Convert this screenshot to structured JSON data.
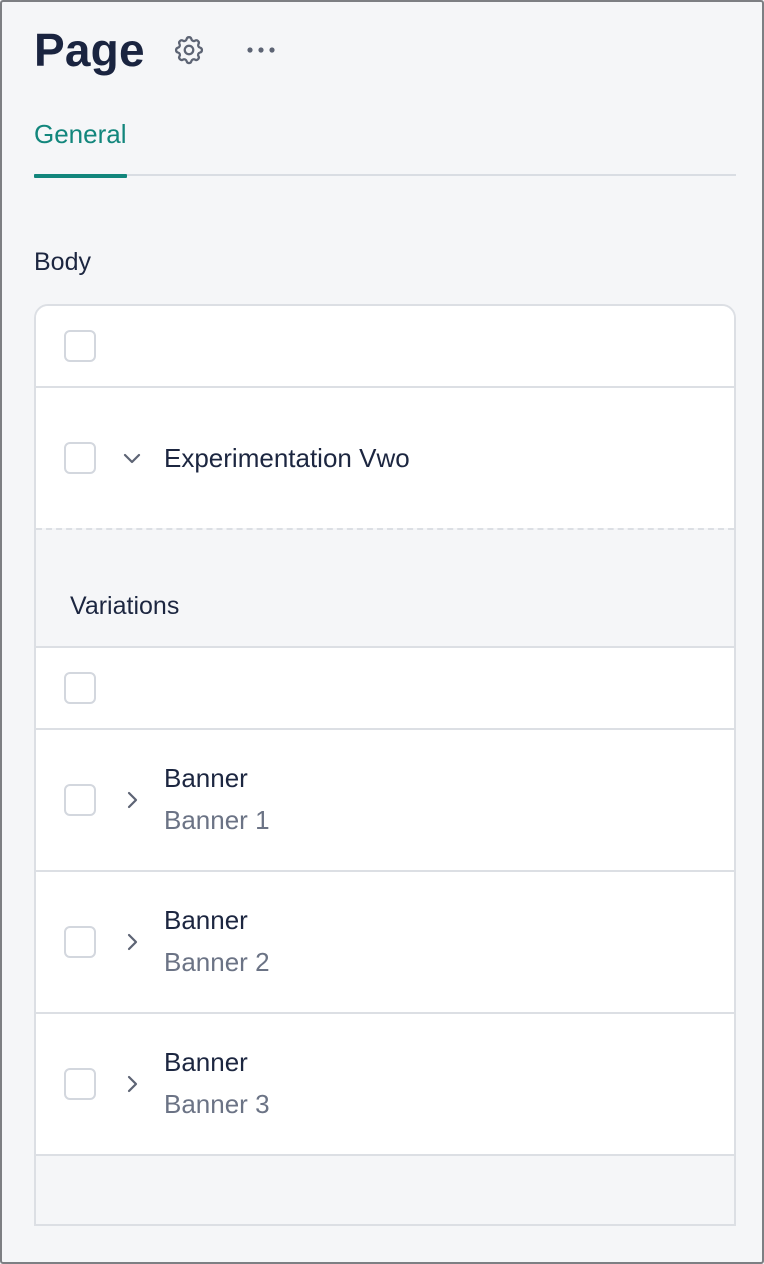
{
  "header": {
    "title": "Page",
    "settings_icon": "gear-icon",
    "more_icon": "more-horizontal-icon"
  },
  "tabs": [
    {
      "label": "General",
      "active": true
    }
  ],
  "body_section": {
    "label": "Body",
    "experiment": {
      "title": "Experimentation Vwo",
      "expanded": true
    },
    "variations": {
      "label": "Variations",
      "items": [
        {
          "type": "Banner",
          "name": "Banner 1"
        },
        {
          "type": "Banner",
          "name": "Banner 2"
        },
        {
          "type": "Banner",
          "name": "Banner 3"
        }
      ]
    }
  },
  "colors": {
    "accent": "#12867c",
    "text_primary": "#1c2640",
    "text_secondary": "#6b7385",
    "background": "#f5f6f8",
    "border": "#dcdfe4"
  }
}
